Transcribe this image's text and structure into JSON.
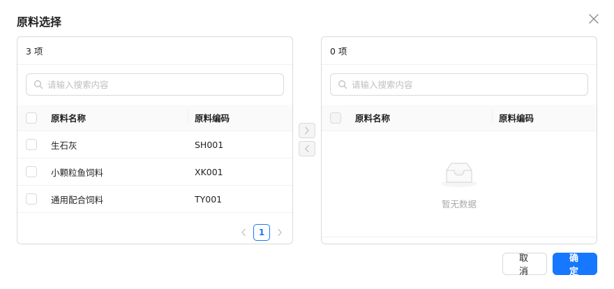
{
  "modal": {
    "title": "原料选择",
    "close_icon": "close-icon"
  },
  "left_panel": {
    "count_label": "3 项",
    "search_placeholder": "请输入搜索内容",
    "columns": [
      "原料名称",
      "原料编码"
    ],
    "rows": [
      {
        "name": "生石灰",
        "code": "SH001"
      },
      {
        "name": "小颗粒鱼饲料",
        "code": "XK001"
      },
      {
        "name": "通用配合饲料",
        "code": "TY001"
      }
    ],
    "pagination": {
      "current_page": "1"
    }
  },
  "right_panel": {
    "count_label": "0 项",
    "search_placeholder": "请输入搜索内容",
    "columns": [
      "原料名称",
      "原料编码"
    ],
    "empty_text": "暂无数据"
  },
  "transfer_ops": {
    "move_right_icon": "chevron-right-icon",
    "move_left_icon": "chevron-left-icon"
  },
  "footer": {
    "cancel_label": "取消",
    "ok_label": "确定"
  },
  "colors": {
    "primary": "#1677ff",
    "border": "#d9d9d9",
    "header_bg": "#fafafa"
  }
}
